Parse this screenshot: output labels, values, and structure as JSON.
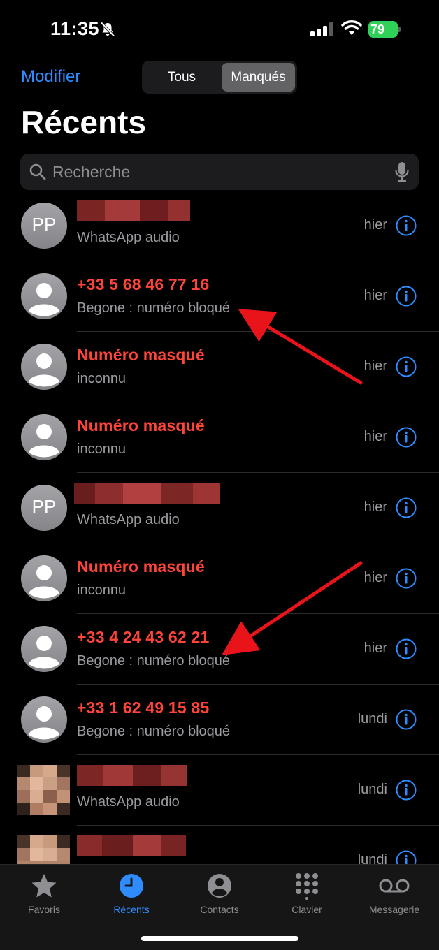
{
  "status_bar": {
    "time": "11:35",
    "battery": "79"
  },
  "nav": {
    "edit_label": "Modifier",
    "segments": [
      "Tous",
      "Manqués"
    ],
    "selected_segment": "Manqués"
  },
  "title": "Récents",
  "search": {
    "placeholder": "Recherche"
  },
  "calls": [
    {
      "name": "",
      "name_hidden": true,
      "subtitle": "WhatsApp audio",
      "when": "hier",
      "avatar": "PP",
      "missed": false
    },
    {
      "name": "+33 5 68 46 77 16",
      "subtitle": "Begone : numéro bloqué",
      "when": "hier",
      "avatar": "generic",
      "missed": true
    },
    {
      "name": "Numéro masqué",
      "subtitle": "inconnu",
      "when": "hier",
      "avatar": "generic",
      "missed": true
    },
    {
      "name": "Numéro masqué",
      "subtitle": "inconnu",
      "when": "hier",
      "avatar": "generic",
      "missed": true
    },
    {
      "name": "",
      "name_hidden": true,
      "subtitle": "WhatsApp audio",
      "when": "hier",
      "avatar": "PP",
      "missed": false
    },
    {
      "name": "Numéro masqué",
      "subtitle": "inconnu",
      "when": "hier",
      "avatar": "generic",
      "missed": true
    },
    {
      "name": "+33 4 24 43 62 21",
      "subtitle": "Begone : numéro bloqué",
      "when": "hier",
      "avatar": "generic",
      "missed": true
    },
    {
      "name": "+33 1 62 49 15 85",
      "subtitle": "Begone : numéro bloqué",
      "when": "lundi",
      "avatar": "generic",
      "missed": true
    },
    {
      "name": "",
      "name_hidden": true,
      "subtitle": "WhatsApp audio",
      "when": "lundi",
      "avatar": "photo",
      "missed": false
    },
    {
      "name": "",
      "name_hidden": true,
      "subtitle": "",
      "when": "lundi",
      "avatar": "photo",
      "missed": false
    }
  ],
  "tabs": [
    {
      "label": "Favoris",
      "icon": "star-icon",
      "active": false
    },
    {
      "label": "Récents",
      "icon": "clock-icon",
      "active": true
    },
    {
      "label": "Contacts",
      "icon": "person-circle-icon",
      "active": false
    },
    {
      "label": "Clavier",
      "icon": "keypad-icon",
      "active": false
    },
    {
      "label": "Messagerie",
      "icon": "voicemail-icon",
      "active": false
    }
  ],
  "colors": {
    "accent": "#2f8cff",
    "missed": "#ff453a",
    "annotation_arrow": "#e8141a"
  }
}
